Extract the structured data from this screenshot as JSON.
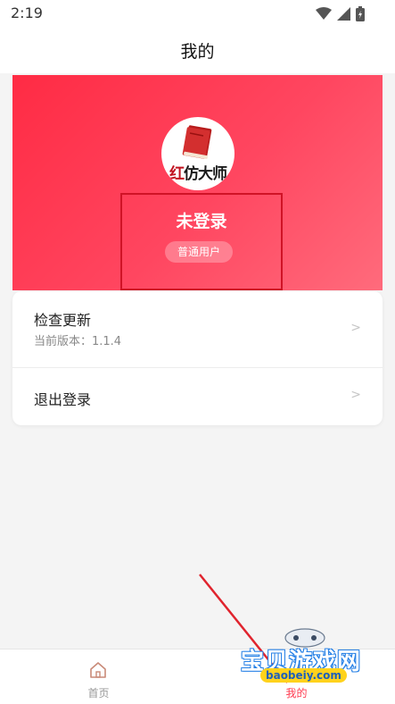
{
  "status_bar": {
    "time": "2:19",
    "icons": [
      "wifi-icon",
      "signal-icon",
      "battery-charging-icon"
    ]
  },
  "nav": {
    "title": "我的"
  },
  "profile": {
    "avatar_text_red": "红",
    "avatar_text_dark": "仿大师",
    "login_status": "未登录",
    "user_type": "普通用户",
    "header_color": "#ff3a52"
  },
  "settings": {
    "items": [
      {
        "label": "检查更新",
        "sub_label": "当前版本：1.1.4",
        "arrow": ">"
      },
      {
        "label": "退出登录",
        "arrow": ">"
      }
    ]
  },
  "tab_bar": {
    "tabs": [
      {
        "label": "首页",
        "icon": "home-icon"
      },
      {
        "label": "我的",
        "icon": "user-icon"
      }
    ],
    "active_color": "#ff3a4f"
  },
  "watermark": {
    "title": "宝贝游戏网",
    "url": "baobeiy.com"
  }
}
